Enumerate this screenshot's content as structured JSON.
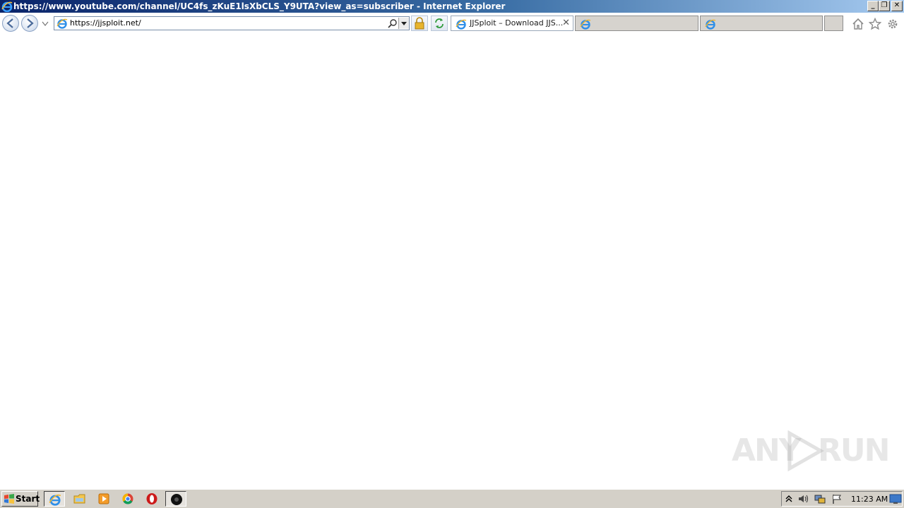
{
  "window": {
    "title": "https://www.youtube.com/channel/UC4fs_zKuE1lsXbCLS_Y9UTA?view_as=subscriber - Internet Explorer",
    "controls": {
      "minimize": "_",
      "restore": "❐",
      "close": "✕"
    }
  },
  "address_bar": {
    "url": "https://jjsploit.net/"
  },
  "tabs": [
    {
      "label": "JJSploit – Download JJS...",
      "active": true,
      "close": "✕"
    },
    {
      "label": "",
      "active": false
    },
    {
      "label": "",
      "active": false
    }
  ],
  "watermark": {
    "left": "ANY",
    "right": "RUN"
  },
  "taskbar": {
    "start_label": "Start",
    "clock": "11:23 AM"
  },
  "colors": {
    "title_gradient_start": "#0a246a",
    "title_gradient_end": "#a6caf0",
    "taskbar": "#d4d0c8"
  }
}
